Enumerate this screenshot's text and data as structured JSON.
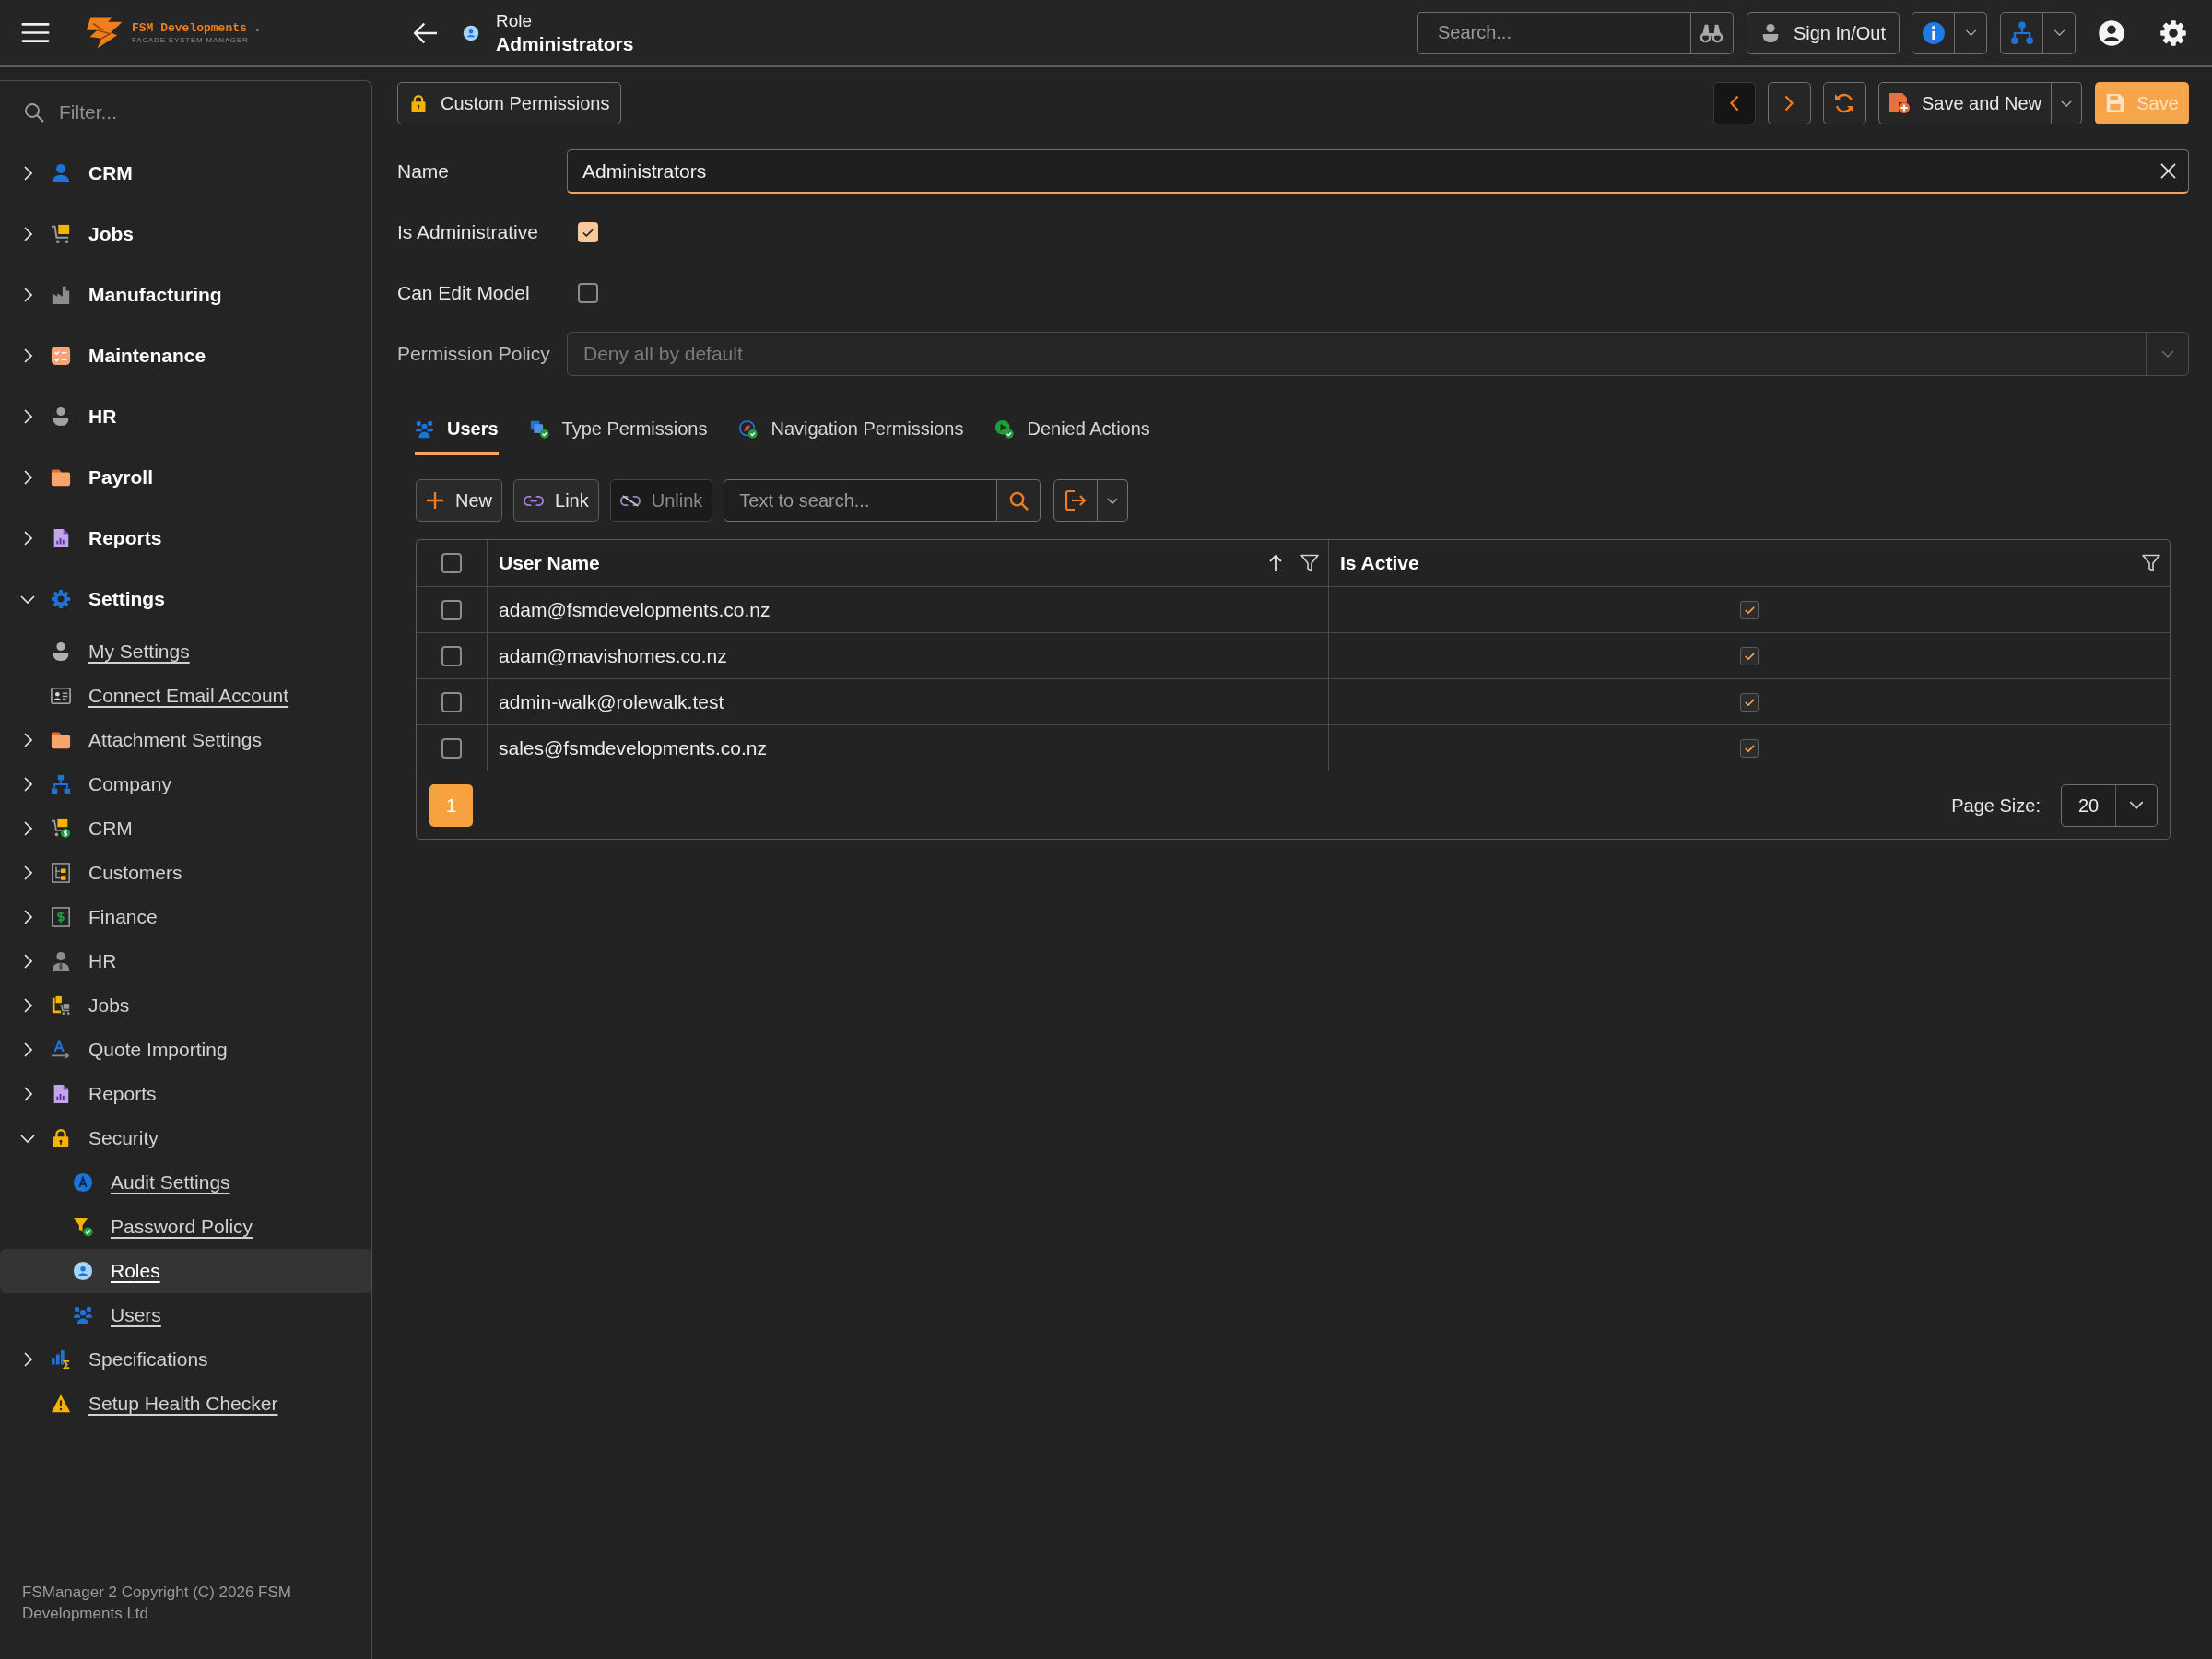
{
  "top_bar": {
    "logo": {
      "name": "FSM Developments .",
      "tagline": "FACADE SYSTEM MANAGER"
    },
    "page": {
      "caption": "Role",
      "title": "Administrators"
    },
    "search": {
      "placeholder": "Search..."
    },
    "sign_in_button": "Sign In/Out"
  },
  "sidebar": {
    "filter": {
      "placeholder": "Filter..."
    },
    "items": [
      {
        "label": "CRM",
        "kind": "group",
        "expanded": false,
        "selected": false
      },
      {
        "label": "Jobs",
        "kind": "group",
        "expanded": false,
        "selected": false
      },
      {
        "label": "Manufacturing",
        "kind": "group",
        "expanded": false,
        "selected": false
      },
      {
        "label": "Maintenance",
        "kind": "group",
        "expanded": false,
        "selected": false
      },
      {
        "label": "HR",
        "kind": "group",
        "expanded": false,
        "selected": false
      },
      {
        "label": "Payroll",
        "kind": "group",
        "expanded": false,
        "selected": false
      },
      {
        "label": "Reports",
        "kind": "group",
        "expanded": false,
        "selected": false
      },
      {
        "label": "Settings",
        "kind": "group",
        "expanded": true,
        "selected": false,
        "children": [
          {
            "label": "My Settings",
            "kind": "link",
            "selected": false
          },
          {
            "label": "Connect Email Account",
            "kind": "link",
            "selected": false
          },
          {
            "label": "Attachment Settings",
            "kind": "group",
            "expanded": false,
            "selected": false
          },
          {
            "label": "Company",
            "kind": "group",
            "expanded": false,
            "selected": false
          },
          {
            "label": "CRM",
            "kind": "group",
            "expanded": false,
            "selected": false
          },
          {
            "label": "Customers",
            "kind": "group",
            "expanded": false,
            "selected": false
          },
          {
            "label": "Finance",
            "kind": "group",
            "expanded": false,
            "selected": false
          },
          {
            "label": "HR",
            "kind": "group",
            "expanded": false,
            "selected": false
          },
          {
            "label": "Jobs",
            "kind": "group",
            "expanded": false,
            "selected": false
          },
          {
            "label": "Quote Importing",
            "kind": "group",
            "expanded": false,
            "selected": false
          },
          {
            "label": "Reports",
            "kind": "group",
            "expanded": false,
            "selected": false
          },
          {
            "label": "Security",
            "kind": "group",
            "expanded": true,
            "selected": false,
            "children": [
              {
                "label": "Audit Settings",
                "kind": "link",
                "selected": false
              },
              {
                "label": "Password Policy",
                "kind": "link",
                "selected": false
              },
              {
                "label": "Roles",
                "kind": "link",
                "selected": true
              },
              {
                "label": "Users",
                "kind": "link",
                "selected": false
              }
            ]
          },
          {
            "label": "Specifications",
            "kind": "group",
            "expanded": false,
            "selected": false
          },
          {
            "label": "Setup Health Checker",
            "kind": "link",
            "selected": false
          }
        ]
      }
    ],
    "footer": "FSManager 2 Copyright (C) 2026 FSM Developments Ltd"
  },
  "record_toolbar": {
    "custom_permissions_button": "Custom Permissions",
    "save_and_new_button": "Save and New",
    "save_button": {
      "label": "Save",
      "disabled": true
    }
  },
  "form": {
    "fields": [
      {
        "kind": "text",
        "label": "Name",
        "value": "Administrators",
        "focused": true,
        "disabled": false
      },
      {
        "kind": "checkbox",
        "label": "Is Administrative",
        "checked": true,
        "focused": false,
        "disabled": false
      },
      {
        "kind": "checkbox",
        "label": "Can Edit Model",
        "checked": false,
        "focused": false,
        "disabled": false
      },
      {
        "kind": "select",
        "label": "Permission Policy",
        "value": "Deny all by default",
        "focused": false,
        "disabled": true
      }
    ]
  },
  "tabs": [
    {
      "label": "Users",
      "selected": true
    },
    {
      "label": "Type Permissions",
      "selected": false
    },
    {
      "label": "Navigation Permissions",
      "selected": false
    },
    {
      "label": "Denied Actions",
      "selected": false
    }
  ],
  "users_toolbar": {
    "buttons": [
      {
        "kind": "new",
        "label": "New",
        "disabled": false
      },
      {
        "kind": "link",
        "label": "Link",
        "disabled": false
      },
      {
        "kind": "unlink",
        "label": "Unlink",
        "disabled": true
      }
    ],
    "search": {
      "placeholder": "Text to search..."
    }
  },
  "table": {
    "select_all_checked": false,
    "columns": [
      {
        "label": "User Name",
        "sorted": true
      },
      {
        "label": "Is Active",
        "sorted": false
      }
    ],
    "rows": [
      {
        "selected": false,
        "user_name": "adam@fsmdevelopments.co.nz",
        "is_active": true
      },
      {
        "selected": false,
        "user_name": "adam@mavishomes.co.nz",
        "is_active": true
      },
      {
        "selected": false,
        "user_name": "admin-walk@rolewalk.test",
        "is_active": true
      },
      {
        "selected": false,
        "user_name": "sales@fsmdevelopments.co.nz",
        "is_active": true
      }
    ],
    "pager": {
      "pages": [
        {
          "label": "1",
          "selected": true
        }
      ],
      "page_size_label": "Page Size:",
      "page_size": "20"
    }
  }
}
